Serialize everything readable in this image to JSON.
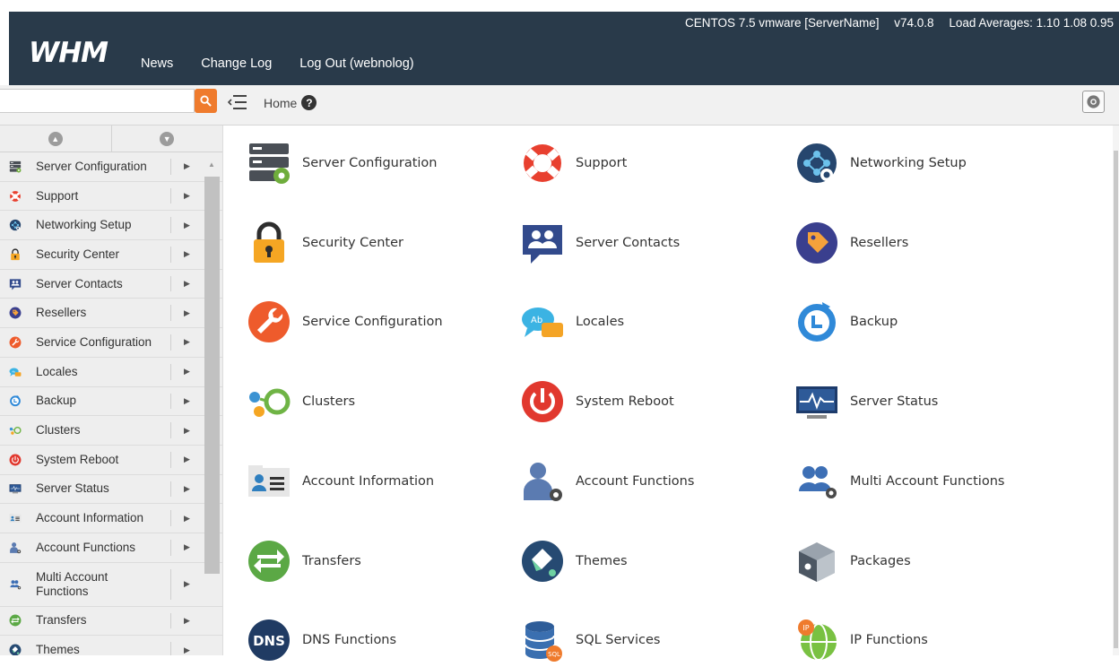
{
  "header": {
    "os": "CENTOS 7.5 vmware [ServerName]",
    "version": "v74.0.8",
    "load": "Load Averages: 1.10 1.08 0.95",
    "logo": "WHM",
    "nav": [
      "News",
      "Change Log",
      "Log Out (webnolog)"
    ]
  },
  "toolbar": {
    "search_placeholder": "",
    "breadcrumb": "Home"
  },
  "sidebar": {
    "items": [
      {
        "label": "Server Configuration",
        "icon": "server-config-icon"
      },
      {
        "label": "Support",
        "icon": "lifebuoy-icon"
      },
      {
        "label": "Networking Setup",
        "icon": "network-icon"
      },
      {
        "label": "Security Center",
        "icon": "padlock-icon"
      },
      {
        "label": "Server Contacts",
        "icon": "contacts-icon"
      },
      {
        "label": "Resellers",
        "icon": "tag-icon"
      },
      {
        "label": "Service Configuration",
        "icon": "wrench-icon"
      },
      {
        "label": "Locales",
        "icon": "speech-bubble-icon"
      },
      {
        "label": "Backup",
        "icon": "backup-clock-icon"
      },
      {
        "label": "Clusters",
        "icon": "clusters-icon"
      },
      {
        "label": "System Reboot",
        "icon": "power-icon"
      },
      {
        "label": "Server Status",
        "icon": "monitor-icon"
      },
      {
        "label": "Account Information",
        "icon": "id-card-icon"
      },
      {
        "label": "Account Functions",
        "icon": "user-gear-icon"
      },
      {
        "label": "Multi Account Functions",
        "icon": "users-gear-icon"
      },
      {
        "label": "Transfers",
        "icon": "transfer-arrows-icon"
      },
      {
        "label": "Themes",
        "icon": "paint-icon"
      }
    ]
  },
  "main": {
    "tiles": [
      {
        "label": "Server Configuration",
        "icon": "server-config-icon"
      },
      {
        "label": "Support",
        "icon": "lifebuoy-icon"
      },
      {
        "label": "Networking Setup",
        "icon": "network-icon"
      },
      {
        "label": "Security Center",
        "icon": "padlock-icon"
      },
      {
        "label": "Server Contacts",
        "icon": "contacts-icon"
      },
      {
        "label": "Resellers",
        "icon": "tag-icon"
      },
      {
        "label": "Service Configuration",
        "icon": "wrench-icon"
      },
      {
        "label": "Locales",
        "icon": "speech-bubble-icon"
      },
      {
        "label": "Backup",
        "icon": "backup-clock-icon"
      },
      {
        "label": "Clusters",
        "icon": "clusters-icon"
      },
      {
        "label": "System Reboot",
        "icon": "power-icon"
      },
      {
        "label": "Server Status",
        "icon": "monitor-icon"
      },
      {
        "label": "Account Information",
        "icon": "id-card-icon"
      },
      {
        "label": "Account Functions",
        "icon": "user-gear-icon"
      },
      {
        "label": "Multi Account Functions",
        "icon": "users-gear-icon"
      },
      {
        "label": "Transfers",
        "icon": "transfer-arrows-icon"
      },
      {
        "label": "Themes",
        "icon": "paint-icon"
      },
      {
        "label": "Packages",
        "icon": "box-icon"
      },
      {
        "label": "DNS Functions",
        "icon": "dns-icon",
        "icon_text": "DNS"
      },
      {
        "label": "SQL Services",
        "icon": "database-icon",
        "icon_text": "SQL"
      },
      {
        "label": "IP Functions",
        "icon": "globe-ip-icon",
        "icon_text": "IP"
      }
    ]
  },
  "colors": {
    "header_bg": "#293a4a",
    "search_accent": "#ef7b2d",
    "sidebar_bg": "#eeeeee"
  }
}
